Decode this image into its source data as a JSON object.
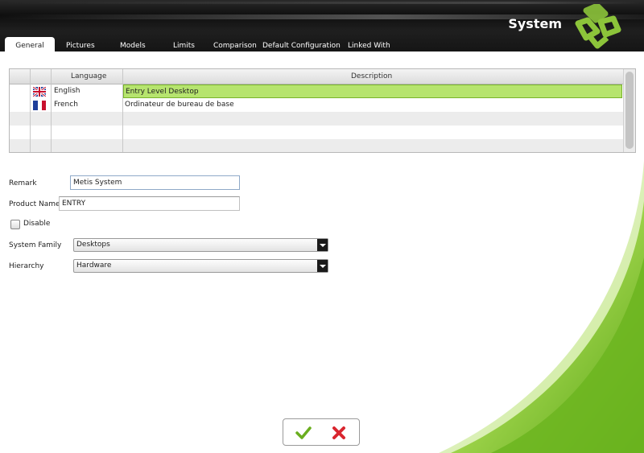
{
  "header": {
    "title": "System"
  },
  "tabs": [
    {
      "label": "General",
      "active": true
    },
    {
      "label": "Pictures"
    },
    {
      "label": "Models"
    },
    {
      "label": "Limits"
    },
    {
      "label": "Comparison"
    },
    {
      "label": "Default Configuration"
    },
    {
      "label": "Linked With"
    }
  ],
  "table": {
    "columns": [
      "Language",
      "Description"
    ],
    "rows": [
      {
        "flag": "uk-flag-icon",
        "language": "English",
        "description": "Entry Level Desktop",
        "selected": true
      },
      {
        "flag": "france-flag-icon",
        "language": "French",
        "description": "Ordinateur de bureau de base"
      }
    ]
  },
  "form": {
    "remark_label": "Remark",
    "remark_value": "Metis System",
    "product_name_label": "Product Name",
    "product_name_value": "ENTRY",
    "disable_label": "Disable",
    "disable_checked": false,
    "system_family_label": "System Family",
    "system_family_value": "Desktops",
    "hierarchy_label": "Hierarchy",
    "hierarchy_value": "Hardware"
  },
  "actions": {
    "confirm": "check-icon",
    "cancel": "cross-icon"
  },
  "colors": {
    "accent_green": "#8cc43a",
    "selection": "#b6e46e",
    "header_bg": "#151515"
  }
}
